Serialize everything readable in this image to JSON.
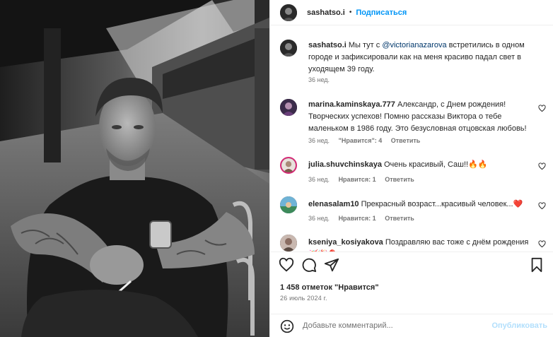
{
  "post": {
    "username": "sashatso.i",
    "follow_label": "Подписаться",
    "separator": "•"
  },
  "caption": {
    "username": "sashatso.i",
    "text_before": " Мы тут с ",
    "mention": "@victorianazarova",
    "text_after": " встретились в одном городе и зафиксировали как на меня красиво падал свет в уходящем 39 году.",
    "time": "36 нед."
  },
  "comments": [
    {
      "username": "marina.kaminskaya.777",
      "text": " Александр, с Днем рождения! Творческих успехов! Помню рассказы Виктора о тебе маленьком в 1986 году. Это безусловная отцовская любовь!",
      "time": "36 нед.",
      "likes": "\"Нравится\": 4",
      "reply": "Ответить"
    },
    {
      "username": "julia.shuvchinskaya",
      "text": " Очень красивый, Саш!!🔥🔥",
      "time": "36 нед.",
      "likes": "Нравится: 1",
      "reply": "Ответить"
    },
    {
      "username": "elenasalam10",
      "text": " Прекрасный возраст...красивый человек...❤️",
      "time": "36 нед.",
      "likes": "Нравится: 1",
      "reply": "Ответить"
    },
    {
      "username": "kseniya_kosiyakova",
      "text": " Поздравляю вас тоже с днём рождения 🥳🎉🎈",
      "time": "",
      "likes": "",
      "reply": ""
    }
  ],
  "likes_text": "1 458 отметок \"Нравится\"",
  "date_text": "26 июль 2024 г.",
  "add_comment": {
    "placeholder": "Добавьте комментарий...",
    "publish_label": "Опубликовать"
  },
  "icons": {
    "like": "heart-icon",
    "comment": "comment-icon",
    "share": "share-icon",
    "save": "bookmark-icon",
    "emoji": "emoji-icon"
  },
  "colors": {
    "link": "#0095f6",
    "mention": "#00376b",
    "muted": "#737373",
    "publish_disabled": "#b2dffc"
  }
}
